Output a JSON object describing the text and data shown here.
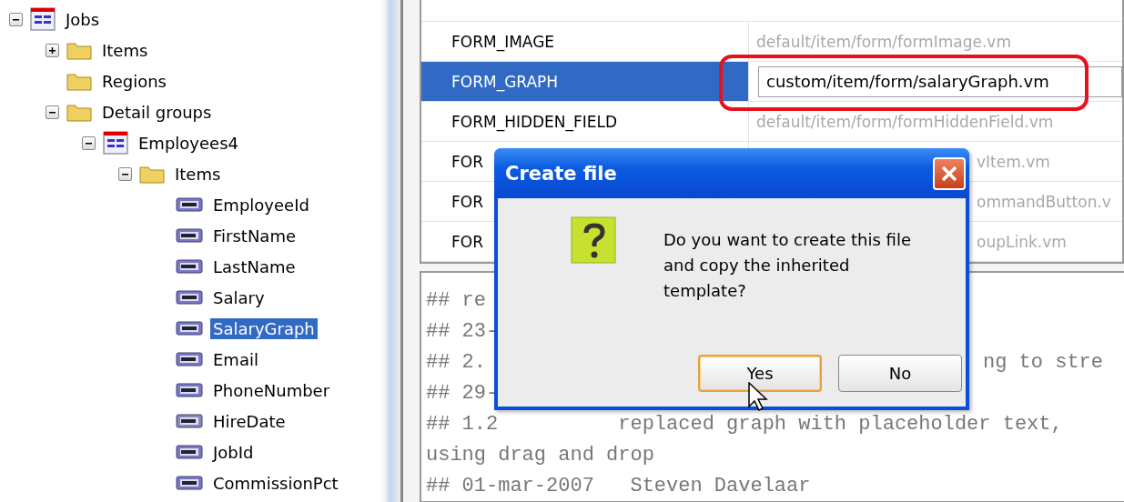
{
  "tree": [
    {
      "label": "Jobs",
      "kind": "table",
      "expanded": true,
      "selected": false,
      "children": [
        {
          "label": "Items",
          "kind": "folder",
          "expanded": false,
          "selected": false
        },
        {
          "label": "Regions",
          "kind": "folder",
          "selected": false
        },
        {
          "label": "Detail groups",
          "kind": "folder",
          "expanded": true,
          "selected": false,
          "children": [
            {
              "label": "Employees4",
              "kind": "table",
              "expanded": true,
              "selected": false,
              "children": [
                {
                  "label": "Items",
                  "kind": "folder",
                  "expanded": true,
                  "selected": false,
                  "children": [
                    {
                      "label": "EmployeeId",
                      "kind": "number",
                      "selected": false
                    },
                    {
                      "label": "FirstName",
                      "kind": "text",
                      "selected": false
                    },
                    {
                      "label": "LastName",
                      "kind": "text",
                      "selected": false
                    },
                    {
                      "label": "Salary",
                      "kind": "number",
                      "selected": false
                    },
                    {
                      "label": "SalaryGraph",
                      "kind": "number",
                      "selected": true
                    },
                    {
                      "label": "Email",
                      "kind": "text",
                      "selected": false
                    },
                    {
                      "label": "PhoneNumber",
                      "kind": "text",
                      "selected": false
                    },
                    {
                      "label": "HireDate",
                      "kind": "date",
                      "selected": false
                    },
                    {
                      "label": "JobId",
                      "kind": "text",
                      "selected": false
                    },
                    {
                      "label": "CommissionPct",
                      "kind": "number",
                      "selected": false
                    }
                  ]
                }
              ]
            }
          ]
        }
      ]
    }
  ],
  "templates": {
    "rows": [
      {
        "name": "FORM_IMAGE",
        "value": "default/item/form/formImage.vm",
        "selected": false,
        "kind": "plain"
      },
      {
        "name": "FORM_GRAPH",
        "value": "custom/item/form/salaryGraph.vm",
        "selected": true,
        "kind": "edit"
      },
      {
        "name": "FORM_HIDDEN_FIELD",
        "value": "default/item/form/formHiddenField.vm",
        "selected": false,
        "kind": "plain"
      },
      {
        "name": "FOR",
        "value": "vItem.vm",
        "selected": false,
        "kind": "covered"
      },
      {
        "name": "FOR",
        "value": "ommandButton.v",
        "selected": false,
        "kind": "covered"
      },
      {
        "name": "FOR",
        "value": "oupLink.vm",
        "selected": false,
        "kind": "covered"
      }
    ]
  },
  "editor": {
    "lines": [
      {
        "left": "## re"
      },
      {
        "left": "## 23-"
      },
      {
        "left": "## 2.",
        "right": "ng to stre"
      },
      {
        "left": "## 29-"
      },
      {
        "left": "## 1.2          replaced graph with placeholder text,"
      },
      {
        "left": "using drag and drop"
      },
      {
        "left": "## 01-mar-2007   Steven Davelaar"
      }
    ]
  },
  "dialog": {
    "title": "Create file",
    "message": "Do you want to create this file and copy the inherited template?",
    "buttons": [
      {
        "label": "Yes",
        "focused": true
      },
      {
        "label": "No",
        "focused": false
      }
    ]
  }
}
